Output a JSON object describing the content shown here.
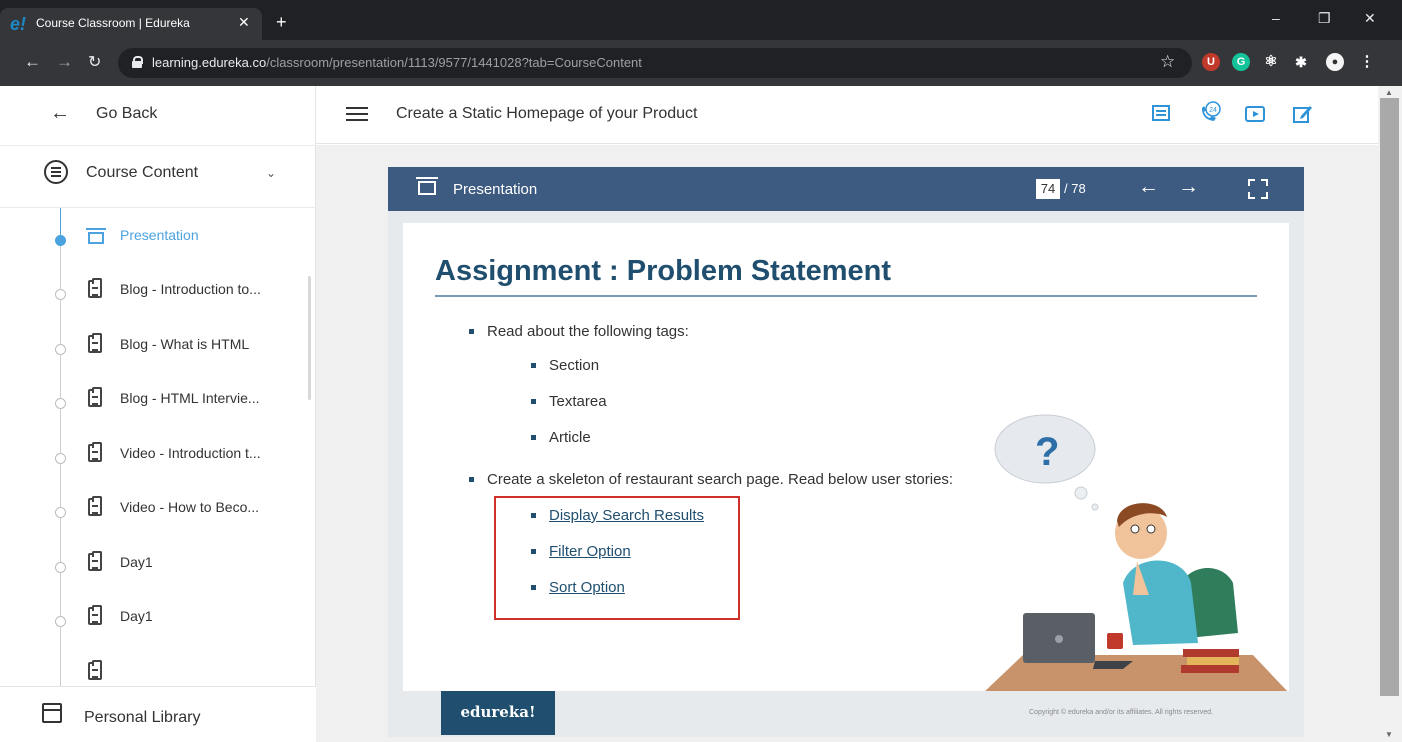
{
  "browser": {
    "tab_title": "Course Classroom | Edureka",
    "tab_favicon": "e!",
    "new_tab": "+",
    "url_host": "learning.edureka.co",
    "url_path": "/classroom/presentation/1113/9577/1441028?tab=CourseContent",
    "window_controls": [
      "–",
      "❐",
      "✕"
    ]
  },
  "sidebar": {
    "go_back": "Go Back",
    "course_content": "Course Content",
    "items": [
      {
        "label": "Presentation",
        "icon": "presentation-icon",
        "active": true
      },
      {
        "label": "Blog - Introduction to...",
        "icon": "clipboard-icon"
      },
      {
        "label": "Blog - What is HTML",
        "icon": "clipboard-icon"
      },
      {
        "label": "Blog - HTML Intervie...",
        "icon": "clipboard-icon"
      },
      {
        "label": "Video - Introduction t...",
        "icon": "clipboard-icon"
      },
      {
        "label": "Video - How to Beco...",
        "icon": "clipboard-icon"
      },
      {
        "label": "Day1",
        "icon": "clipboard-icon"
      },
      {
        "label": "Day1",
        "icon": "clipboard-icon"
      }
    ],
    "personal_library": "Personal Library"
  },
  "header": {
    "title": "Create a Static Homepage of your Product",
    "accent": "#2f93d8",
    "support_badge": "24"
  },
  "viewer": {
    "label": "Presentation",
    "page_current": "74",
    "page_total": "/ 78",
    "prev": "←",
    "next": "→"
  },
  "slide": {
    "title": "Assignment : Problem Statement",
    "bullet1": "Read about the following tags:",
    "sub1": [
      "Section",
      "Textarea",
      "Article"
    ],
    "bullet2": "Create a skeleton of restaurant search page. Read below user stories:",
    "sub2": [
      "Display Search Results",
      "Filter Option",
      "Sort Option"
    ],
    "logo": "edureka!",
    "copyright": "Copyright © edureka and/or its affiliates. All rights reserved.",
    "question_mark": "?"
  }
}
